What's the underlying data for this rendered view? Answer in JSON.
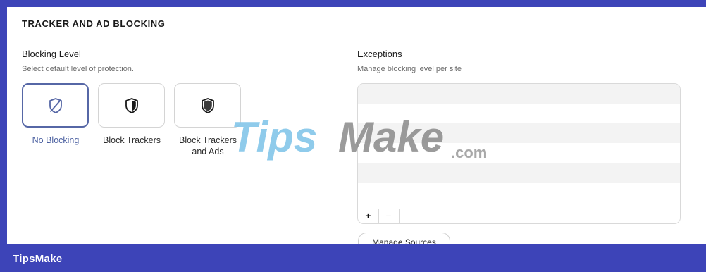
{
  "section": {
    "title": "TRACKER AND AD BLOCKING"
  },
  "blocking_level": {
    "heading": "Blocking Level",
    "subtext": "Select default level of protection.",
    "options": [
      {
        "label": "No Blocking",
        "icon": "shield-off-icon",
        "selected": true
      },
      {
        "label": "Block Trackers",
        "icon": "shield-icon",
        "selected": false
      },
      {
        "label": "Block Trackers and Ads",
        "icon": "shield-full-icon",
        "selected": false
      }
    ],
    "selected_color": "#5667a6"
  },
  "exceptions": {
    "heading": "Exceptions",
    "subtext": "Manage blocking level per site",
    "add_label": "+",
    "remove_label": "−",
    "manage_sources_label": "Manage Sources"
  },
  "watermark": {
    "tips": "Tips",
    "make": "Make",
    "com": ".com"
  },
  "brand": {
    "name": "TipsMake",
    "color": "#3d44b8"
  }
}
